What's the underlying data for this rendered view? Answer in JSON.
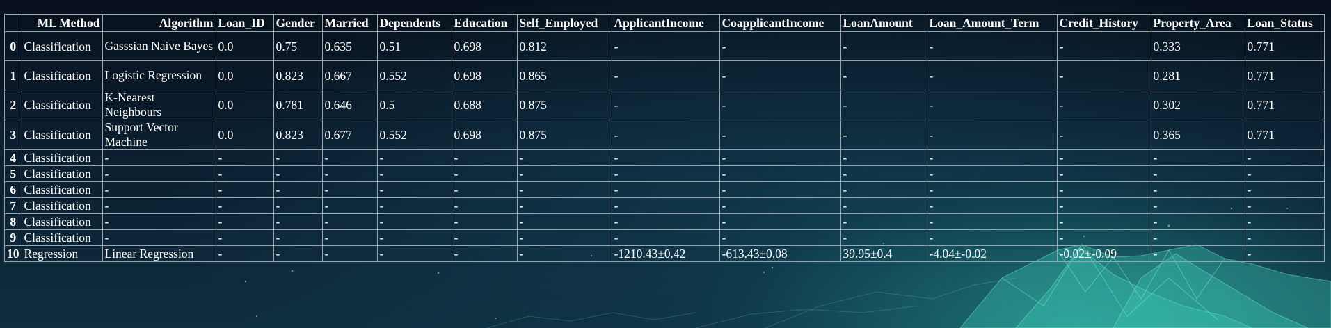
{
  "table": {
    "columns": [
      "",
      "ML Method",
      "Algorithm",
      "Loan_ID",
      "Gender",
      "Married",
      "Dependents",
      "Education",
      "Self_Employed",
      "ApplicantIncome",
      "CoapplicantIncome",
      "LoanAmount",
      "Loan_Amount_Term",
      "Credit_History",
      "Property_Area",
      "Loan_Status"
    ],
    "rows": [
      [
        "0",
        "Classification",
        "Gasssian Naive Bayes",
        "0.0",
        "0.75",
        "0.635",
        "0.51",
        "0.698",
        "0.812",
        "-",
        "-",
        "-",
        "-",
        "-",
        "0.333",
        "0.771"
      ],
      [
        "1",
        "Classification",
        "Logistic Regression",
        "0.0",
        "0.823",
        "0.667",
        "0.552",
        "0.698",
        "0.865",
        "-",
        "-",
        "-",
        "-",
        "-",
        "0.281",
        "0.771"
      ],
      [
        "2",
        "Classification",
        "K-Nearest Neighbours",
        "0.0",
        "0.781",
        "0.646",
        "0.5",
        "0.688",
        "0.875",
        "-",
        "-",
        "-",
        "-",
        "-",
        "0.302",
        "0.771"
      ],
      [
        "3",
        "Classification",
        "Support Vector Machine",
        "0.0",
        "0.823",
        "0.677",
        "0.552",
        "0.698",
        "0.875",
        "-",
        "-",
        "-",
        "-",
        "-",
        "0.365",
        "0.771"
      ],
      [
        "4",
        "Classification",
        "-",
        "-",
        "-",
        "-",
        "-",
        "-",
        "-",
        "-",
        "-",
        "-",
        "-",
        "-",
        "-",
        "-"
      ],
      [
        "5",
        "Classification",
        "-",
        "-",
        "-",
        "-",
        "-",
        "-",
        "-",
        "-",
        "-",
        "-",
        "-",
        "-",
        "-",
        "-"
      ],
      [
        "6",
        "Classification",
        "-",
        "-",
        "-",
        "-",
        "-",
        "-",
        "-",
        "-",
        "-",
        "-",
        "-",
        "-",
        "-",
        "-"
      ],
      [
        "7",
        "Classification",
        "-",
        "-",
        "-",
        "-",
        "-",
        "-",
        "-",
        "-",
        "-",
        "-",
        "-",
        "-",
        "-",
        "-"
      ],
      [
        "8",
        "Classification",
        "-",
        "-",
        "-",
        "-",
        "-",
        "-",
        "-",
        "-",
        "-",
        "-",
        "-",
        "-",
        "-",
        "-"
      ],
      [
        "9",
        "Classification",
        "-",
        "-",
        "-",
        "-",
        "-",
        "-",
        "-",
        "-",
        "-",
        "-",
        "-",
        "-",
        "-",
        "-"
      ],
      [
        "10",
        "Regression",
        "Linear Regression",
        "-",
        "-",
        "-",
        "-",
        "-",
        "-",
        "-1210.43±0.42",
        "-613.43±0.08",
        "39.95±0.4",
        "-4.04±-0.02",
        "-0.02±-0.09",
        "-",
        "-"
      ]
    ]
  }
}
